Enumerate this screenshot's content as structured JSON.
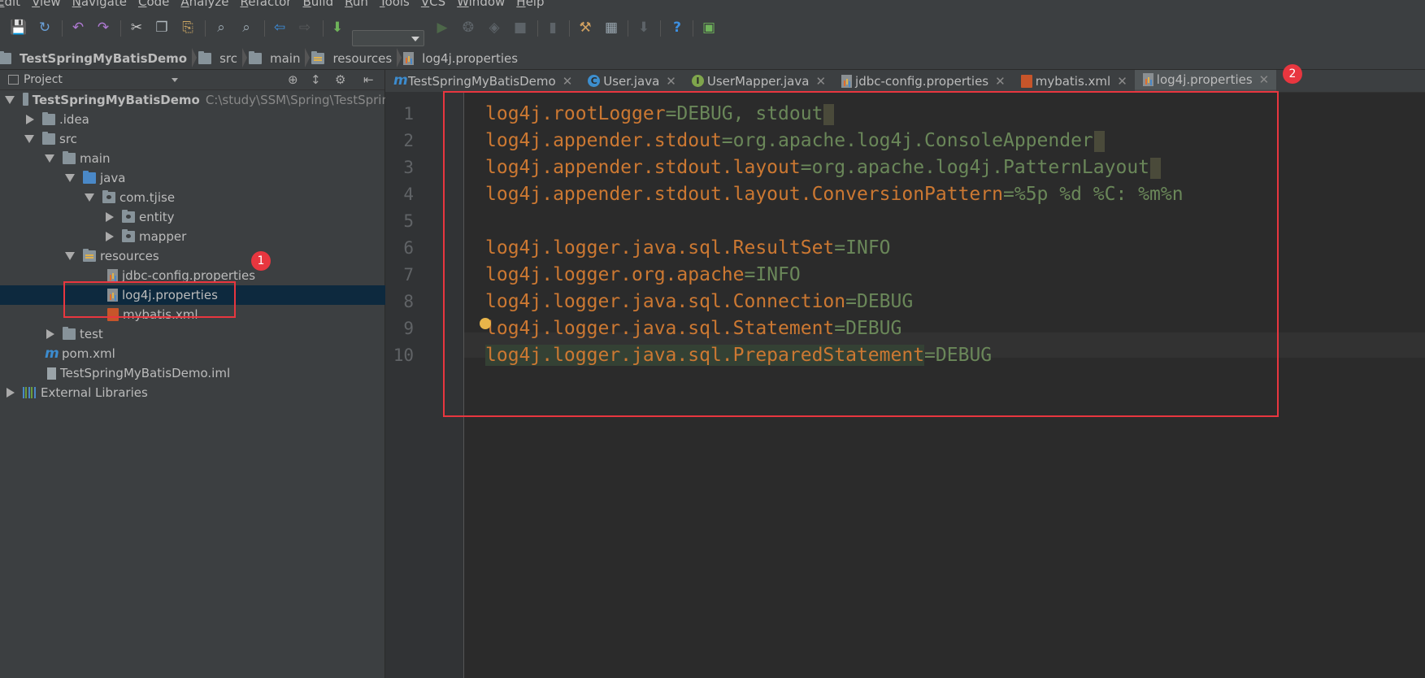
{
  "menu": {
    "items": [
      {
        "first": "E",
        "rest": "dit"
      },
      {
        "first": "V",
        "rest": "iew"
      },
      {
        "first": "N",
        "rest": "avigate"
      },
      {
        "first": "C",
        "rest": "ode"
      },
      {
        "first": "A",
        "rest": "nalyze"
      },
      {
        "first": "R",
        "rest": "efactor"
      },
      {
        "first": "B",
        "rest": "uild"
      },
      {
        "first": "R",
        "rest": "un"
      },
      {
        "first": "T",
        "rest": "ools"
      },
      {
        "first": "V",
        "rest": "CS"
      },
      {
        "first": "W",
        "rest": "indow"
      },
      {
        "first": "H",
        "rest": "elp"
      }
    ]
  },
  "toolbar": {
    "help_label": "?"
  },
  "breadcrumb": [
    {
      "label": "TestSpringMyBatisDemo",
      "icon": "module-folder-icon"
    },
    {
      "label": "src",
      "icon": "folder-icon"
    },
    {
      "label": "main",
      "icon": "folder-icon"
    },
    {
      "label": "resources",
      "icon": "resources-folder-icon"
    },
    {
      "label": "log4j.properties",
      "icon": "properties-file-icon"
    }
  ],
  "project_panel": {
    "title": "Project",
    "tree": {
      "root_label": "TestSpringMyBatisDemo",
      "root_path": "C:\\study\\SSM\\Spring\\TestSprin",
      "idea": ".idea",
      "src": "src",
      "main": "main",
      "java": "java",
      "package": "com.tjise",
      "entity": "entity",
      "mapper": "mapper",
      "resources": "resources",
      "jdbc": "jdbc-config.properties",
      "log4j": "log4j.properties",
      "mybatis": "mybatis.xml",
      "test": "test",
      "pom": "pom.xml",
      "iml": "TestSpringMyBatisDemo.iml",
      "external": "External Libraries"
    }
  },
  "tabs": [
    {
      "label": "TestSpringMyBatisDemo",
      "icon": "m-icon"
    },
    {
      "label": "User.java",
      "icon": "class-icon"
    },
    {
      "label": "UserMapper.java",
      "icon": "interface-icon"
    },
    {
      "label": "jdbc-config.properties",
      "icon": "properties-file-icon"
    },
    {
      "label": "mybatis.xml",
      "icon": "xml-file-icon"
    },
    {
      "label": "log4j.properties",
      "icon": "properties-file-icon",
      "active": true
    }
  ],
  "editor": {
    "lines": [
      {
        "n": "1",
        "key": "log4j.rootLogger",
        "eq": "=",
        "val": "DEBUG, stdout"
      },
      {
        "n": "2",
        "key": "log4j.appender.stdout",
        "eq": "=",
        "val": "org.apache.log4j.ConsoleAppender"
      },
      {
        "n": "3",
        "key": "log4j.appender.stdout.layout",
        "eq": "=",
        "val": "org.apache.log4j.PatternLayout"
      },
      {
        "n": "4",
        "key": "log4j.appender.stdout.layout.ConversionPattern",
        "eq": "=",
        "val": "%5p %d %C: %m%n"
      },
      {
        "n": "5",
        "key": "",
        "eq": "",
        "val": ""
      },
      {
        "n": "6",
        "key": "log4j.logger.java.sql.ResultSet",
        "eq": "=",
        "val": "INFO"
      },
      {
        "n": "7",
        "key": "log4j.logger.org.apache",
        "eq": "=",
        "val": "INFO"
      },
      {
        "n": "8",
        "key": "log4j.logger.java.sql.Connection",
        "eq": "=",
        "val": "DEBUG"
      },
      {
        "n": "9",
        "key": "log4j.logger.java.sql.Statement",
        "eq": "=",
        "val": "DEBUG"
      },
      {
        "n": "10",
        "key": "log4j.logger.java.sql.PreparedStatement",
        "eq": "=",
        "val": "DEBUG"
      }
    ]
  },
  "annotations": {
    "badge1": "1",
    "badge2": "2",
    "color": "#e8363f"
  },
  "colors": {
    "keyword": "#cc7832",
    "value": "#6a8759",
    "selection": "#0d293e",
    "background": "#2b2b2b",
    "panel": "#3c3f41"
  }
}
